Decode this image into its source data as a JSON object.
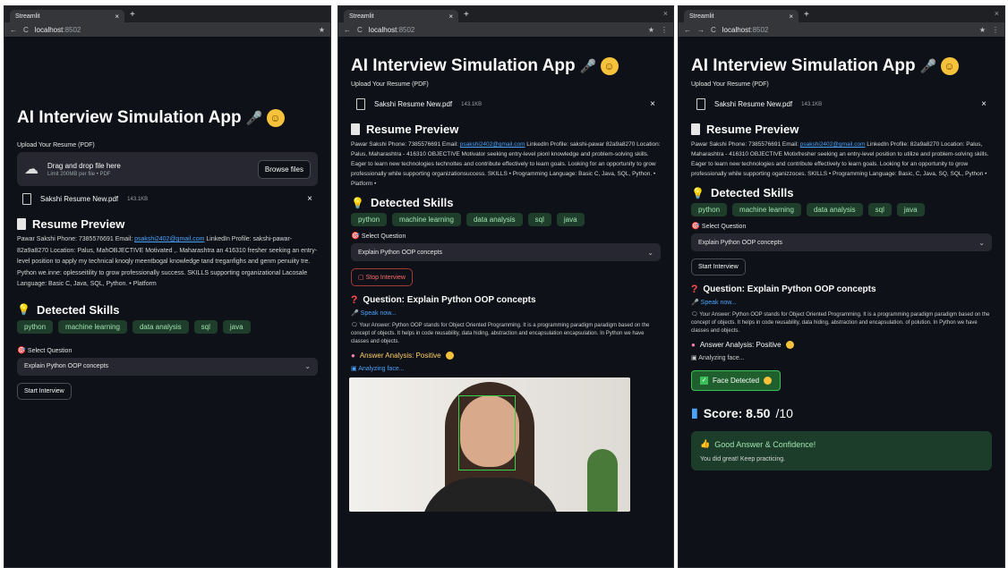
{
  "browser": {
    "tab_title": "Streamlit",
    "tab_close": "×",
    "new_tab": "+",
    "window_close": "×",
    "back_icon": "←",
    "forward_icon": "→",
    "reload_icon": "C",
    "url_host": "localhost",
    "url_port": ":8502",
    "star_icon": "★",
    "menu_icon": "⋮"
  },
  "app": {
    "title": "AI Interview Simulation App",
    "upload_label": "Upload Your Resume (PDF)",
    "dropzone_main": "Drag and drop file here",
    "dropzone_sub": "Limit 200MB per file • PDF",
    "browse_label": "Browse files",
    "file_name": "Sakshi Resume New.pdf",
    "file_size": "143.1KB",
    "file_remove": "×",
    "resume_preview_heading": "Resume Preview",
    "detected_skills_heading": "Detected Skills",
    "select_question_label": "Select Question",
    "selected_question": "Explain Python OOP concepts",
    "start_button": "Start Interview",
    "stop_button": "Stop Interview",
    "question_heading": "Question: Explain Python OOP concepts",
    "speak_now": "Speak now...",
    "answer_analysis": "Answer Analysis: Positive",
    "analyzing_face": "Analyzing face...",
    "face_detected": "Face Detected",
    "score_label": "Score: 8.50",
    "score_of": "/10",
    "good_title": "Good Answer & Confidence!",
    "good_sub": "You did great! Keep practicing."
  },
  "skills": [
    "python",
    "machine learning",
    "data analysis",
    "sql",
    "java"
  ],
  "panel1_resume": {
    "before_email": "Pawar Sakshi Phone: 7385576691 Email: ",
    "email": "psakshi2402@gmail.com",
    "after_email": " LinkedIn Profile: sakshi-pawar-82a9a8270 Location: Palus, MahOBJECTIVE Motivated ,. Maharashtra an 416310 fresher seeking an entry-level position to apply my technical knoqly meentbogal knowledge tand treganfighs and genm penuiity tre. Python we.inne: oplesseitility to grow professionally success. SKILLS supporting organizational Lacosale Language: Basic C, Java, SQL, Python. • Platform"
  },
  "panel2_resume": {
    "before_email": "Pawar Sakshi Phone: 7385576691 Email: ",
    "email": "psakshi2402@gmail.com",
    "after_email": " LinkedIn Profile: sakshi-pawar 82a9a8270 Location: Palus, Maharashtra - 416310 OBJECTIVE Motivator seeking entry-level pionl knowledge and problem-solving skills. Eager to learn new technologies technoltes and contribute effectively to learn goals. Looking for an opportunity to grow professionally while supporting organizationsuccess. SKILLS • Programming Language: Basic C, Java, SQL, Python. • Platform •"
  },
  "panel3_resume": {
    "before_email": "Pawar Sakshi Phone: 7385576691 Email: ",
    "email": "psakshi2402@gmail.com",
    "after_email": " LinkedIn Profile: 82a9a8270 Location: Palus, Maharashtra - 416310 OBJECTIVE Motixfresher seeking an entry-level position to utilize and problem-solving skills. Eager to learn new technologies and contribute effectively to learn goals. Looking for an opportunity to grow professionally while supporting oganizzoces. SKILLS • Programming Language: Basic, C, Java, SQ, SQL, Python •"
  },
  "panel2_answer": "Your Answer: Python OOP stands for Object Oriented Programming. It is a programming paradigm paradigm based on the concept of objects. It helps in code reusability, data hiding, abstraction and encapsulation encapsulation. In Python we have classes and objects.",
  "panel3_answer": "Your Answer: Python OOP stands for Object Oriented Programming. It is a programming paradigm paradigm based on the concept of objects. It helps in code reusability, data hiding, abstraction and encapsulation. of polution. In Python we have classes and objects."
}
